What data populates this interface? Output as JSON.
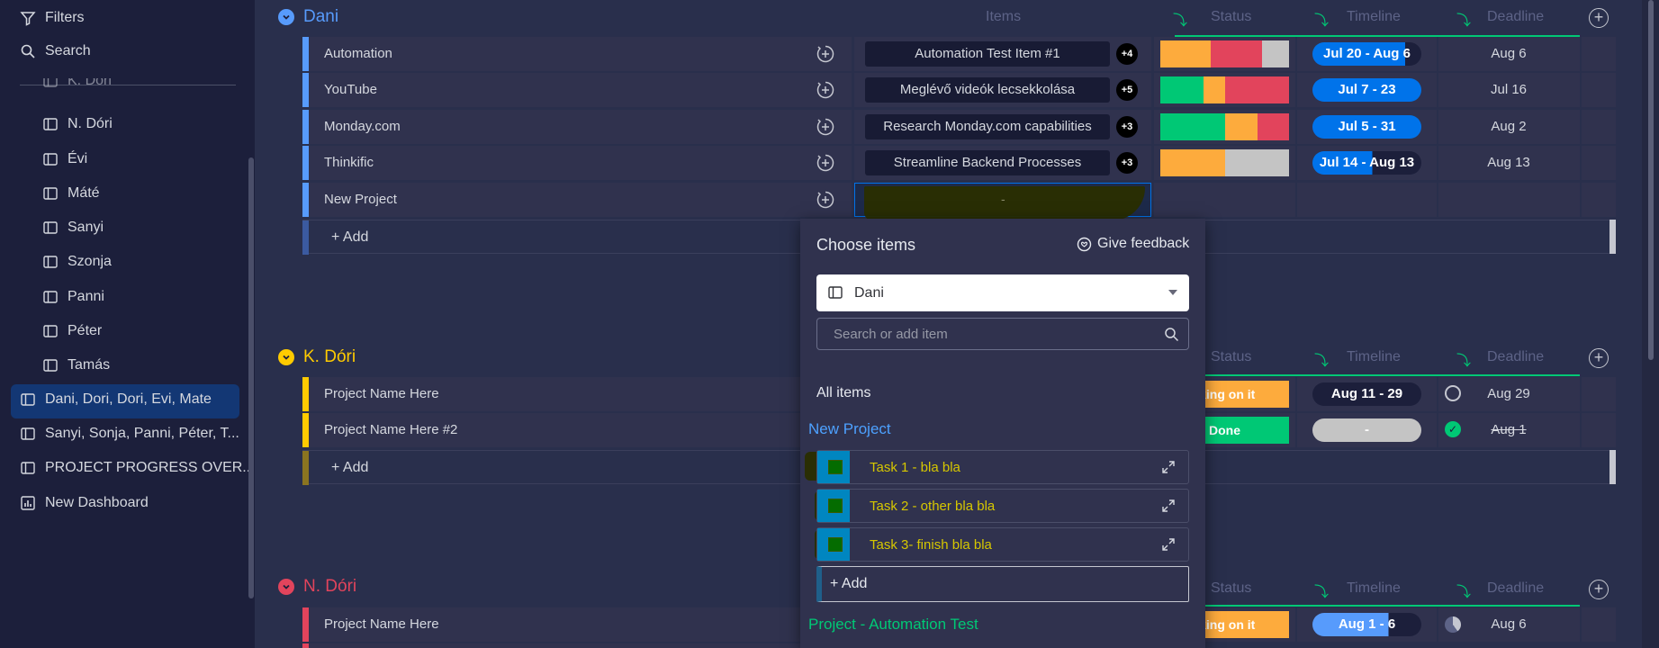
{
  "sidebar": {
    "filters_label": "Filters",
    "search_label": "Search",
    "boards": [
      {
        "label": "K. Dóri"
      },
      {
        "label": "N. Dóri"
      },
      {
        "label": "Évi"
      },
      {
        "label": "Máté"
      },
      {
        "label": "Sanyi"
      },
      {
        "label": "Szonja"
      },
      {
        "label": "Panni"
      },
      {
        "label": "Péter"
      },
      {
        "label": "Tamás"
      }
    ],
    "dashboards": [
      {
        "label": "Dani, Dori, Dori, Evi, Mate"
      },
      {
        "label": "Sanyi, Sonja, Panni, Péter, T..."
      },
      {
        "label": "PROJECT PROGRESS OVER..."
      },
      {
        "label": "New Dashboard"
      }
    ]
  },
  "columns": {
    "items": "Items",
    "status": "Status",
    "timeline": "Timeline",
    "deadline": "Deadline"
  },
  "groups": {
    "dani": {
      "title": "Dani",
      "color": "#579bfc",
      "rows": [
        {
          "name": "Automation",
          "item": "Automation Test Item #1",
          "count": "+4",
          "timeline": "Jul 20 - Aug 6",
          "deadline": "Aug 6"
        },
        {
          "name": "YouTube",
          "item": "Meglévő videók lecsekkolása",
          "count": "+5",
          "timeline": "Jul 7 - 23",
          "deadline": "Jul 16"
        },
        {
          "name": "Monday.com",
          "item": "Research Monday.com capabilities",
          "count": "+3",
          "timeline": "Jul 5 - 31",
          "deadline": "Aug 2"
        },
        {
          "name": "Thinkific",
          "item": "Streamline Backend Processes",
          "count": "+3",
          "timeline": "Jul 14 - Aug 13",
          "deadline": "Aug 13"
        },
        {
          "name": "New Project",
          "item": "-",
          "count": "",
          "timeline": "",
          "deadline": ""
        }
      ],
      "add_label": "+ Add"
    },
    "kdori": {
      "title": "K. Dóri",
      "color": "#ffcb00",
      "rows": [
        {
          "name": "Project Name Here",
          "status": "rking on it",
          "timeline": "Aug 11 - 29",
          "deadline": "Aug 29"
        },
        {
          "name": "Project Name Here #2",
          "status": "Done",
          "timeline": "-",
          "deadline": "Aug 1"
        }
      ],
      "add_label": "+ Add"
    },
    "ndori": {
      "title": "N. Dóri",
      "color": "#e2445c",
      "rows": [
        {
          "name": "Project Name Here",
          "status": "rking on it",
          "timeline": "Aug 1 - 6",
          "deadline": "Aug 6"
        }
      ]
    }
  },
  "popup": {
    "title": "Choose items",
    "feedback_label": "Give feedback",
    "board_select": "Dani",
    "search_placeholder": "Search or add item",
    "all_items_label": "All items",
    "group1_title": "New Project",
    "tasks": [
      {
        "name": "Task 1 - bla bla"
      },
      {
        "name": "Task 2 - other bla bla"
      },
      {
        "name": "Task 3- finish bla bla"
      }
    ],
    "add_label": "+ Add",
    "group2_title": "Project - Automation Test"
  },
  "colors": {
    "status_done": "#00c875",
    "status_working": "#fdab3d",
    "status_stuck": "#e2445c",
    "status_empty": "#c4c4c4",
    "timeline_blue": "#0073ea"
  }
}
